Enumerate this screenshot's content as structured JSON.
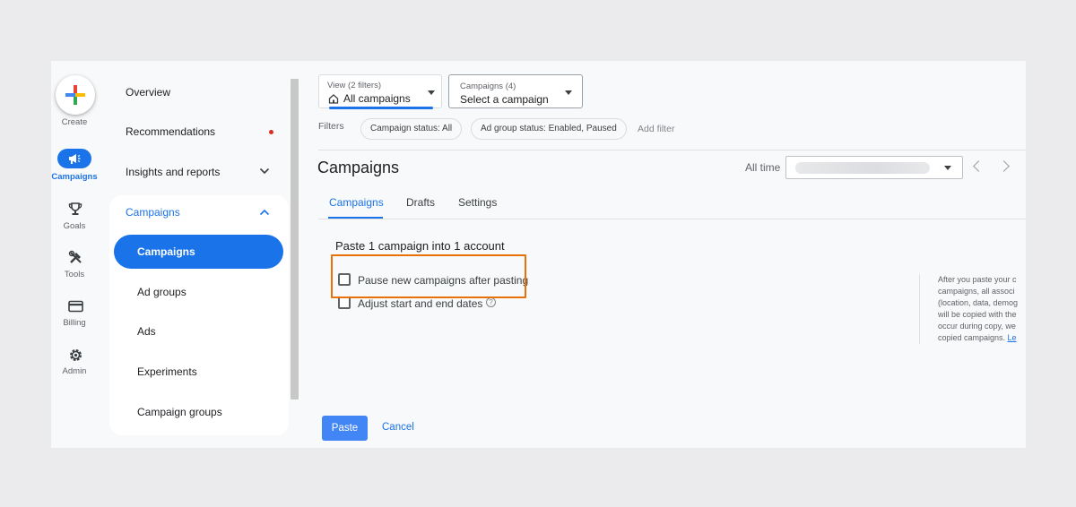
{
  "rail": {
    "create_label": "Create",
    "items": [
      {
        "label": "Campaigns",
        "icon": "megaphone-icon",
        "active": true
      },
      {
        "label": "Goals",
        "icon": "trophy-icon"
      },
      {
        "label": "Tools",
        "icon": "tools-icon"
      },
      {
        "label": "Billing",
        "icon": "credit-card-icon"
      },
      {
        "label": "Admin",
        "icon": "gear-icon"
      }
    ]
  },
  "nav": {
    "overview": "Overview",
    "recommendations": "Recommendations",
    "insights": "Insights and reports",
    "campaigns_group": "Campaigns",
    "sub_items": [
      "Campaigns",
      "Ad groups",
      "Ads",
      "Experiments",
      "Campaign groups"
    ]
  },
  "view_selector": {
    "caption": "View (2 filters)",
    "value": "All campaigns"
  },
  "campaign_selector": {
    "caption": "Campaigns (4)",
    "value": "Select a campaign"
  },
  "filters": {
    "label": "Filters",
    "chips": [
      "Campaign status: All",
      "Ad group status: Enabled, Paused"
    ],
    "add_filter": "Add filter"
  },
  "header": {
    "title": "Campaigns",
    "date_range_label": "All time"
  },
  "tabs": [
    "Campaigns",
    "Drafts",
    "Settings"
  ],
  "paste_panel": {
    "title": "Paste 1 campaign into 1 account",
    "option_pause": "Pause new campaigns after pasting",
    "option_dates": "Adjust start and end dates",
    "help_text_lines": [
      "After you paste your c",
      "campaigns, all associ",
      "(location, data, demog",
      "will be copied with the",
      "occur during copy, we",
      "copied campaigns. "
    ],
    "help_link": "Le"
  },
  "actions": {
    "paste": "Paste",
    "cancel": "Cancel"
  },
  "colors": {
    "accent": "#1a73e8",
    "highlight": "#e8710a",
    "notification_dot": "#d93025"
  }
}
